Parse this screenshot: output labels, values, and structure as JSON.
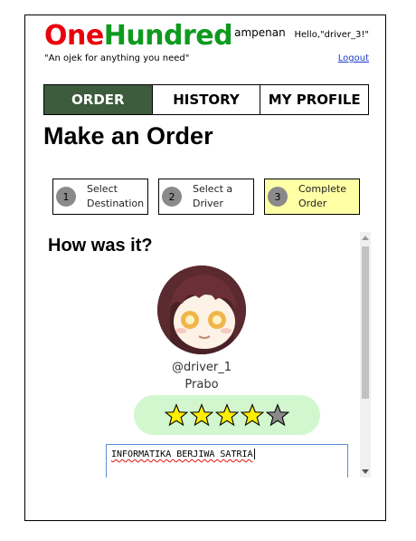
{
  "app": {
    "logo_one": "One",
    "logo_hundred": "Hundred",
    "logo_sup": "ampenan",
    "tagline": "\"An ojek for anything you need\"",
    "greeting": "Hello,\"driver_3!\"",
    "logout_label": "Logout"
  },
  "nav": {
    "tabs": [
      {
        "label": "ORDER",
        "active": true
      },
      {
        "label": "HISTORY",
        "active": false
      },
      {
        "label": "MY PROFILE",
        "active": false
      }
    ]
  },
  "page": {
    "title": "Make an Order"
  },
  "steps": [
    {
      "number": "1",
      "label": "Select\nDestination"
    },
    {
      "number": "2",
      "label": "Select a\nDriver"
    },
    {
      "number": "3",
      "label": "Complete\nOrder",
      "current": true
    }
  ],
  "review": {
    "title": "How was it?",
    "driver_username": "@driver_1",
    "driver_name": "Prabo",
    "rating": {
      "value": 4,
      "max": 5
    },
    "comment_value": "INFORMATIKA BERJIWA SATRIA"
  },
  "colors": {
    "logo_red": "#e8000d",
    "logo_green": "#0e9a1e",
    "active_tab": "#3d5b3d",
    "current_step": "#ffffa6",
    "rating_bg": "#d2f7cf",
    "star_filled": "#ffee00",
    "star_empty": "#8a8a8a"
  }
}
